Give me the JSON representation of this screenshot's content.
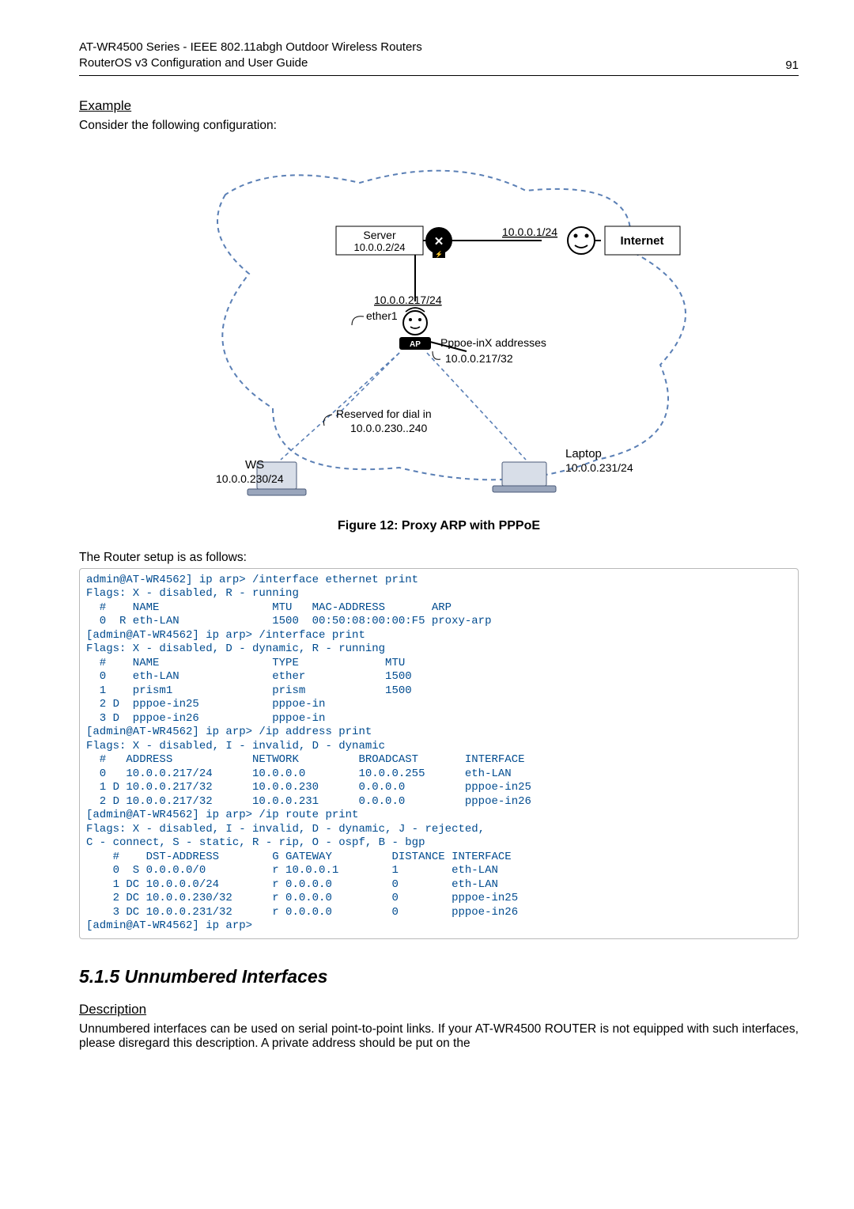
{
  "header": {
    "line1": "AT-WR4500 Series - IEEE 802.11abgh Outdoor Wireless Routers",
    "line2": "RouterOS v3 Configuration and User Guide",
    "page": "91"
  },
  "example": {
    "heading": "Example",
    "intro": "Consider the following configuration:"
  },
  "diagram": {
    "server": "Server",
    "server_ip": "10.0.0.2/24",
    "net_ip": "10.0.0.1/24",
    "internet": "Internet",
    "eth1_ip": "10.0.0.217/24",
    "eth1": "ether1",
    "pppoe": "Pppoe-inX addresses",
    "pppoe_ip": "10.0.0.217/32",
    "reserved": "Reserved for dial in",
    "reserved_ip": "10.0.0.230..240",
    "ws": "WS",
    "ws_ip": "10.0.0.230/24",
    "laptop": "Laptop",
    "laptop_ip": "10.0.0.231/24",
    "ap": "AP"
  },
  "figure_caption": "Figure 12: Proxy ARP with PPPoE",
  "setup_intro": "The Router setup is as follows:",
  "cli": "admin@AT-WR4562] ip arp> /interface ethernet print\nFlags: X - disabled, R - running\n  #    NAME                 MTU   MAC-ADDRESS       ARP\n  0  R eth-LAN              1500  00:50:08:00:00:F5 proxy-arp\n[admin@AT-WR4562] ip arp> /interface print\nFlags: X - disabled, D - dynamic, R - running\n  #    NAME                 TYPE             MTU\n  0    eth-LAN              ether            1500\n  1    prism1               prism            1500\n  2 D  pppoe-in25           pppoe-in\n  3 D  pppoe-in26           pppoe-in\n[admin@AT-WR4562] ip arp> /ip address print\nFlags: X - disabled, I - invalid, D - dynamic\n  #   ADDRESS            NETWORK         BROADCAST       INTERFACE\n  0   10.0.0.217/24      10.0.0.0        10.0.0.255      eth-LAN\n  1 D 10.0.0.217/32      10.0.0.230      0.0.0.0         pppoe-in25\n  2 D 10.0.0.217/32      10.0.0.231      0.0.0.0         pppoe-in26\n[admin@AT-WR4562] ip arp> /ip route print\nFlags: X - disabled, I - invalid, D - dynamic, J - rejected,\nC - connect, S - static, R - rip, O - ospf, B - bgp\n    #    DST-ADDRESS        G GATEWAY         DISTANCE INTERFACE\n    0  S 0.0.0.0/0          r 10.0.0.1        1        eth-LAN\n    1 DC 10.0.0.0/24        r 0.0.0.0         0        eth-LAN\n    2 DC 10.0.0.230/32      r 0.0.0.0         0        pppoe-in25\n    3 DC 10.0.0.231/32      r 0.0.0.0         0        pppoe-in26\n[admin@AT-WR4562] ip arp>",
  "section": {
    "heading": "5.1.5  Unnumbered Interfaces",
    "desc_head": "Description",
    "desc_body": "Unnumbered interfaces can be used on serial point-to-point links. If your AT-WR4500 ROUTER is not equipped with such interfaces, please disregard this description. A private address should be put on the"
  }
}
